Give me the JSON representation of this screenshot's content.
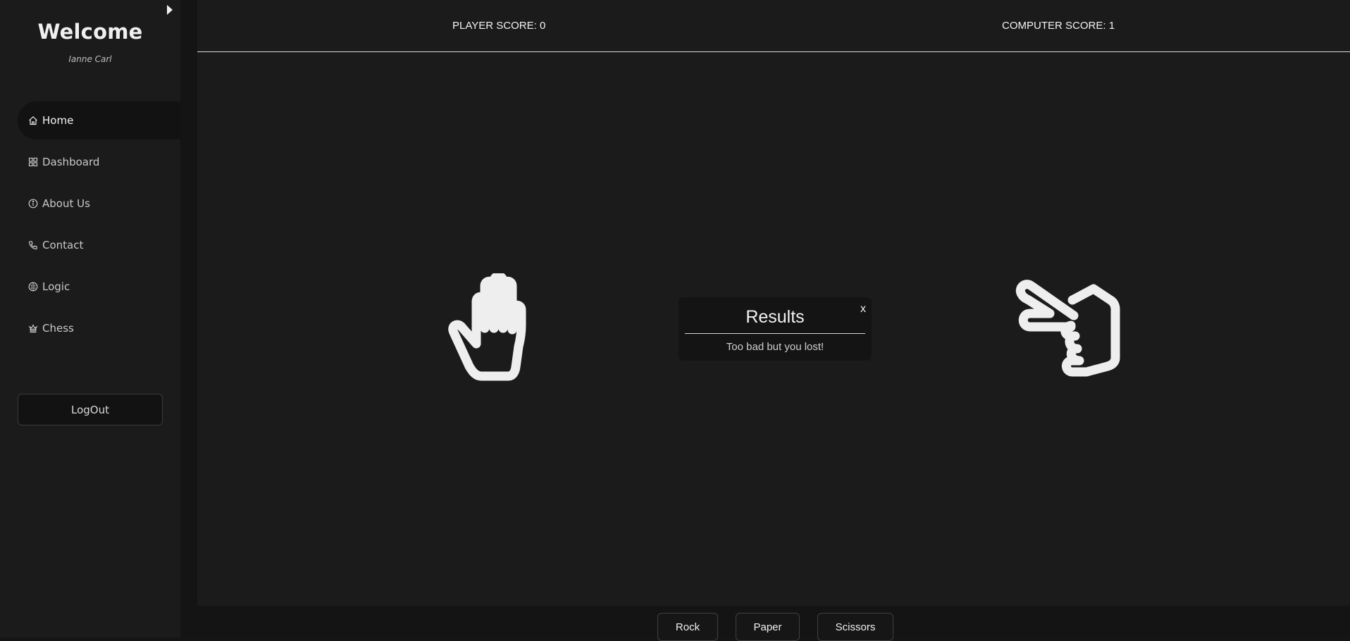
{
  "sidebar": {
    "welcome_title": "Welcome",
    "username": "Ianne Carl",
    "toggle_icon": "caret-right-icon",
    "items": [
      {
        "label": "Home",
        "icon": "home-icon",
        "active": true
      },
      {
        "label": "Dashboard",
        "icon": "grid-icon",
        "active": false
      },
      {
        "label": "About Us",
        "icon": "info-icon",
        "active": false
      },
      {
        "label": "Contact",
        "icon": "phone-icon",
        "active": false
      },
      {
        "label": "Logic",
        "icon": "brain-icon",
        "active": false
      },
      {
        "label": "Chess",
        "icon": "chess-icon",
        "active": false
      }
    ],
    "logout_label": "LogOut"
  },
  "scores": {
    "player_label": "PLAYER SCORE:",
    "player_value": "0",
    "computer_label": "COMPUTER SCORE:",
    "computer_value": "1"
  },
  "board": {
    "player_choice_icon": "hand-paper-icon",
    "computer_choice_icon": "hand-scissors-icon"
  },
  "results": {
    "title": "Results",
    "message": "Too bad but you lost!",
    "close_label": "x"
  },
  "choices": {
    "rock": "Rock",
    "paper": "Paper",
    "scissors": "Scissors"
  },
  "colors": {
    "sidebar_bg": "#1b1b1b",
    "main_bg": "#1b1b1b",
    "panel_bg": "#141414",
    "text": "#f2f2f2"
  }
}
